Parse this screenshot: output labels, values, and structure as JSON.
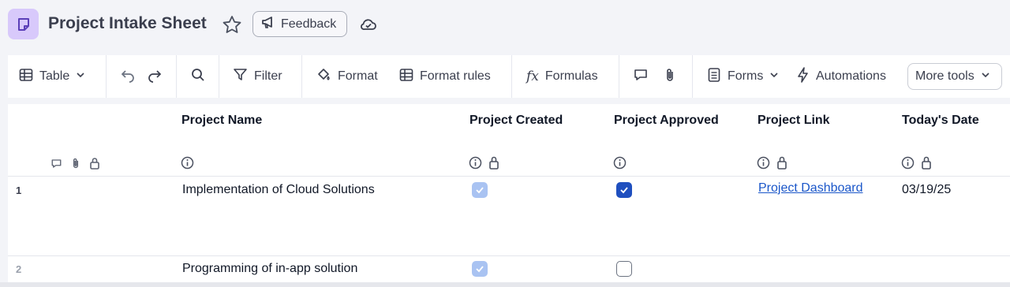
{
  "header": {
    "title": "Project Intake Sheet",
    "feedback_label": "Feedback",
    "icons": [
      "sheet-icon",
      "star-icon",
      "megaphone-icon",
      "cloud-check-icon"
    ]
  },
  "toolbar": {
    "table_label": "Table",
    "filter_label": "Filter",
    "format_label": "Format",
    "format_rules_label": "Format rules",
    "formulas_label": "Formulas",
    "forms_label": "Forms",
    "automations_label": "Automations",
    "more_tools_label": "More tools"
  },
  "grid": {
    "columns": [
      {
        "label": "Project Name"
      },
      {
        "label": "Project Created"
      },
      {
        "label": "Project Approved"
      },
      {
        "label": "Project Link"
      },
      {
        "label": "Today's Date"
      }
    ],
    "rows": [
      {
        "number": "1",
        "project_name": "Implementation of Cloud Solutions",
        "project_created": true,
        "project_approved": true,
        "project_link": "Project Dashboard",
        "todays_date": "03/19/25"
      },
      {
        "number": "2",
        "project_name": "Programming of in-app solution",
        "project_created": true,
        "project_approved": false,
        "project_link": "",
        "todays_date": ""
      }
    ]
  },
  "colors": {
    "accent_purple": "#d8c9fb",
    "checkbox_blue": "#1f4fbf",
    "checkbox_soft": "#a9c3f2",
    "link_blue": "#1a56c9"
  }
}
